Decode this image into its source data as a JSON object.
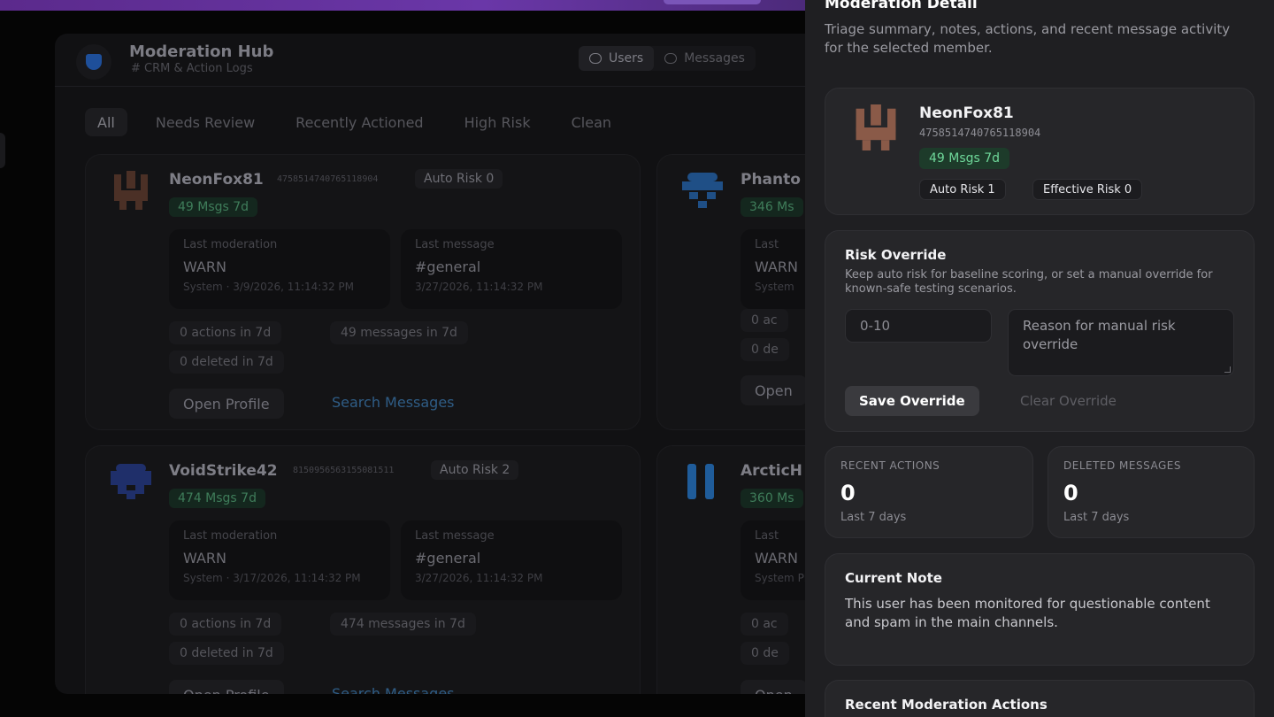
{
  "hub": {
    "title": "Moderation Hub",
    "subtitle": "# CRM & Action Logs",
    "tabs": [
      "Users",
      "Messages"
    ]
  },
  "filters": [
    "All",
    "Needs Review",
    "Recently Actioned",
    "High Risk",
    "Clean"
  ],
  "cards": [
    {
      "name": "NeonFox81",
      "id": "4758514740765118904",
      "risk": "Auto Risk 0",
      "msgs": "49 Msgs 7d",
      "last_moderation_label": "Last moderation",
      "last_moderation": "WARN",
      "last_moderation_meta": "System · 3/9/2026, 11:14:32 PM",
      "last_message_label": "Last message",
      "last_message": "#general",
      "last_message_meta": "3/27/2026, 11:14:32 PM",
      "actions": "0 actions in 7d",
      "messages": "49 messages in 7d",
      "deleted": "0 deleted in 7d",
      "open": "Open Profile",
      "search": "Search Messages"
    },
    {
      "name": "VoidStrike42",
      "id": "8150956563155081511",
      "risk": "Auto Risk 2",
      "msgs": "474 Msgs 7d",
      "last_moderation_label": "Last moderation",
      "last_moderation": "WARN",
      "last_moderation_meta": "System · 3/17/2026, 11:14:32 PM",
      "last_message_label": "Last message",
      "last_message": "#general",
      "last_message_meta": "3/27/2026, 11:14:32 PM",
      "actions": "0 actions in 7d",
      "messages": "474 messages in 7d",
      "deleted": "0 deleted in 7d",
      "open": "Open Profile",
      "search": "Search Messages"
    },
    {
      "name": "Phanto",
      "msgs": "346 Ms",
      "last_moderation_label": "Last",
      "last_moderation": "WARN",
      "last_moderation_meta": "System",
      "actions": "0 ac",
      "deleted": "0 de",
      "open": "Open"
    },
    {
      "name": "ArcticH",
      "msgs": "360 Ms",
      "last_moderation_label": "Last",
      "last_moderation": "WARN",
      "last_moderation_meta": "System PM",
      "actions": "0 ac",
      "deleted": "0 de",
      "open": "Open"
    }
  ],
  "drawer": {
    "title": "Moderation Detail",
    "subtitle": "Triage summary, notes, actions, and recent message activity for the selected member.",
    "member": {
      "name": "NeonFox81",
      "id": "4758514740765118904",
      "msgs": "49 Msgs 7d",
      "auto_risk": "Auto Risk 1",
      "effective_risk": "Effective Risk 0"
    },
    "override": {
      "title": "Risk Override",
      "desc": "Keep auto risk for baseline scoring, or set a manual override for known-safe testing scenarios.",
      "input_placeholder": "0-10",
      "reason_placeholder": "Reason for manual risk override",
      "save": "Save Override",
      "clear": "Clear Override"
    },
    "stats": [
      {
        "label": "RECENT ACTIONS",
        "value": "0",
        "sub": "Last 7 days"
      },
      {
        "label": "DELETED MESSAGES",
        "value": "0",
        "sub": "Last 7 days"
      }
    ],
    "note": {
      "title": "Current Note",
      "text": "This user has been monitored for questionable content and spam in the main channels."
    },
    "recent_actions_title": "Recent Moderation Actions"
  },
  "colors": {
    "accent_green": "#6fd89a",
    "drawer_bg": "#1f1f22",
    "brand_purple": "#6a37a8"
  }
}
